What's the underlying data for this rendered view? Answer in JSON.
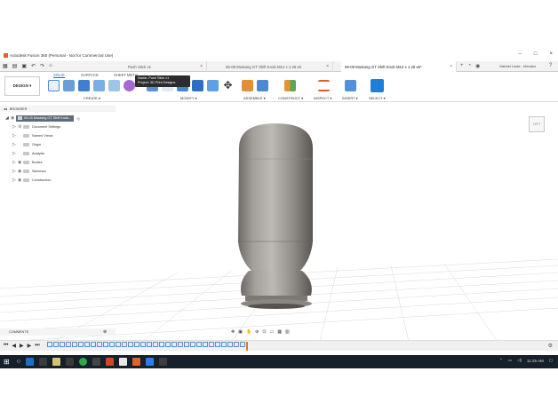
{
  "window": {
    "title": "Autodesk Fusion 360 (Personal - Not for Commercial Use)",
    "minimize": "–",
    "maximize": "□",
    "close": "×"
  },
  "tabs": [
    {
      "label": "Push Stick v1",
      "active": false
    },
    {
      "label": "05-09 Mustang GT Shift Knob M12 x 1.25 v5",
      "active": false
    },
    {
      "label": "05-09 Mustang GT Shift Knob M12 x 1.25 v5*",
      "active": true
    }
  ],
  "user": "Gabriel Lisde - Mendez",
  "ribbon": {
    "workspace": "DESIGN ▾",
    "tabs": [
      "SOLID",
      "SURFACE",
      "SHEET METAL"
    ],
    "groups": [
      "CREATE ▾",
      "MODIFY ▾",
      "ASSEMBLE ▾",
      "CONSTRUCT ▾",
      "INSPECT ▾",
      "INSERT ▾",
      "SELECT ▾"
    ]
  },
  "tooltip": {
    "name": "Name: Push Stick v1",
    "project": "Project: 3D Print Designs"
  },
  "browser": {
    "header": "BROWSER",
    "root": "05-09 Mustang GT Shift Knob...",
    "items": [
      "Document Settings",
      "Named Views",
      "Origin",
      "Analysis",
      "Bodies",
      "Sketches",
      "Construction"
    ]
  },
  "viewcube": "LEFT",
  "comments": "COMMENTS",
  "taskbar": {
    "time": "11:25 AM"
  }
}
